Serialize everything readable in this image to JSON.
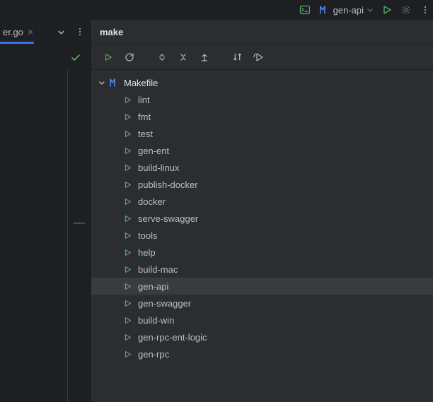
{
  "top": {
    "run_config_label": "gen-api"
  },
  "editor": {
    "tab_name": "er.go"
  },
  "panel": {
    "title": "make",
    "root_label": "Makefile",
    "targets": [
      {
        "name": "lint"
      },
      {
        "name": "fmt"
      },
      {
        "name": "test"
      },
      {
        "name": "gen-ent"
      },
      {
        "name": "build-linux"
      },
      {
        "name": "publish-docker"
      },
      {
        "name": "docker"
      },
      {
        "name": "serve-swagger"
      },
      {
        "name": "tools"
      },
      {
        "name": "help"
      },
      {
        "name": "build-mac"
      },
      {
        "name": "gen-api",
        "selected": true
      },
      {
        "name": "gen-swagger"
      },
      {
        "name": "build-win"
      },
      {
        "name": "gen-rpc-ent-logic"
      },
      {
        "name": "gen-rpc"
      }
    ]
  }
}
